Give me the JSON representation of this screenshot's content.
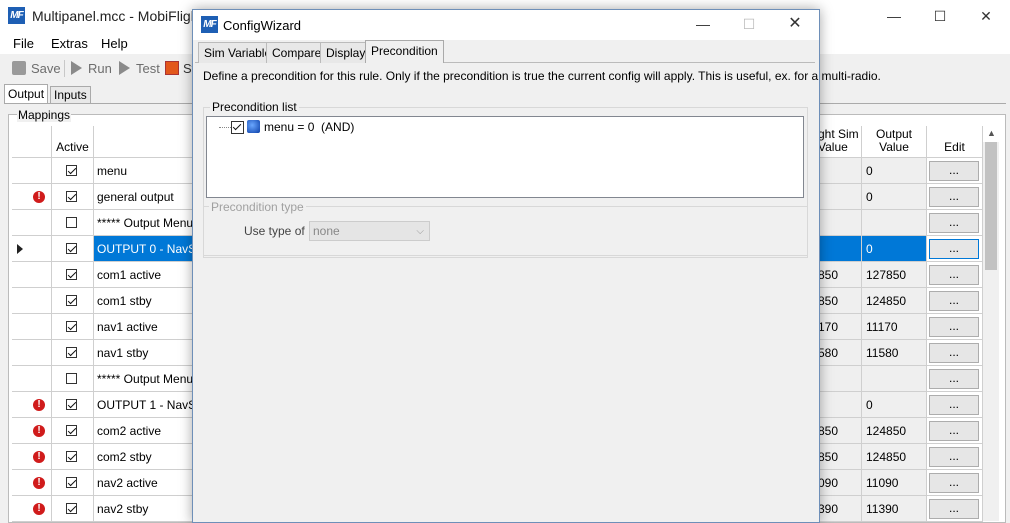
{
  "main_window": {
    "title": "Multipanel.mcc - MobiFlight C",
    "minimize_glyph": "—",
    "maximize_glyph": "☐",
    "close_glyph": "✕"
  },
  "menu": [
    "File",
    "Extras",
    "Help"
  ],
  "toolbar": {
    "save": "Save",
    "run": "Run",
    "test": "Test",
    "st": "St"
  },
  "main_tabs": [
    "Output",
    "Inputs"
  ],
  "mappings_label": "Mappings",
  "grid": {
    "headers": {
      "active": "Active",
      "flight_sim_value": "ght Sim\nValue",
      "output_value": "Output\nValue",
      "edit": "Edit"
    },
    "edit_label": "...",
    "rows": [
      {
        "name": "menu",
        "active": true,
        "warn": false,
        "sim": "",
        "out": "0",
        "selected": false
      },
      {
        "name": "general output",
        "active": true,
        "warn": true,
        "sim": "",
        "out": "0",
        "selected": false
      },
      {
        "name": "***** Output Menu 0",
        "active": false,
        "warn": false,
        "sim": "",
        "out": "",
        "selected": false
      },
      {
        "name": "OUTPUT 0 - NavSta",
        "active": true,
        "warn": false,
        "sim": "",
        "out": "0",
        "selected": true
      },
      {
        "name": "com1 active",
        "active": true,
        "warn": false,
        "sim": "850",
        "out": "127850",
        "selected": false
      },
      {
        "name": "com1 stby",
        "active": true,
        "warn": false,
        "sim": "850",
        "out": "124850",
        "selected": false
      },
      {
        "name": "nav1 active",
        "active": true,
        "warn": false,
        "sim": "170",
        "out": "11170",
        "selected": false
      },
      {
        "name": "nav1 stby",
        "active": true,
        "warn": false,
        "sim": "580",
        "out": "11580",
        "selected": false
      },
      {
        "name": "***** Output Menu 1",
        "active": false,
        "warn": false,
        "sim": "",
        "out": "",
        "selected": false
      },
      {
        "name": "OUTPUT 1 - NavSta",
        "active": true,
        "warn": true,
        "sim": "",
        "out": "0",
        "selected": false
      },
      {
        "name": "com2 active",
        "active": true,
        "warn": true,
        "sim": "850",
        "out": "124850",
        "selected": false
      },
      {
        "name": "com2 stby",
        "active": true,
        "warn": true,
        "sim": "850",
        "out": "124850",
        "selected": false
      },
      {
        "name": "nav2 active",
        "active": true,
        "warn": true,
        "sim": "090",
        "out": "11090",
        "selected": false
      },
      {
        "name": "nav2 stby",
        "active": true,
        "warn": true,
        "sim": "390",
        "out": "11390",
        "selected": false
      }
    ]
  },
  "dialog": {
    "title": "ConfigWizard",
    "minimize_glyph": "—",
    "maximize_glyph": "☐",
    "close_glyph": "✕",
    "tabs": [
      "Sim Variable",
      "Compare",
      "Display",
      "Precondition"
    ],
    "active_tab": "Precondition",
    "description": "Define a precondition for this rule. Only if the precondition is true the current config will apply. This is useful, ex. for a multi-radio.",
    "precondition_list_label": "Precondition list",
    "precondition_item": "menu = 0  (AND)",
    "precondition_item_checked": true,
    "precondition_type_label": "Precondition type",
    "use_type_label": "Use type of",
    "use_type_value": "none"
  },
  "logo_text": "MF",
  "colors": {
    "selection": "#0078d7",
    "accent_logo": "#1e5fb4",
    "warning": "#d01b1b"
  }
}
